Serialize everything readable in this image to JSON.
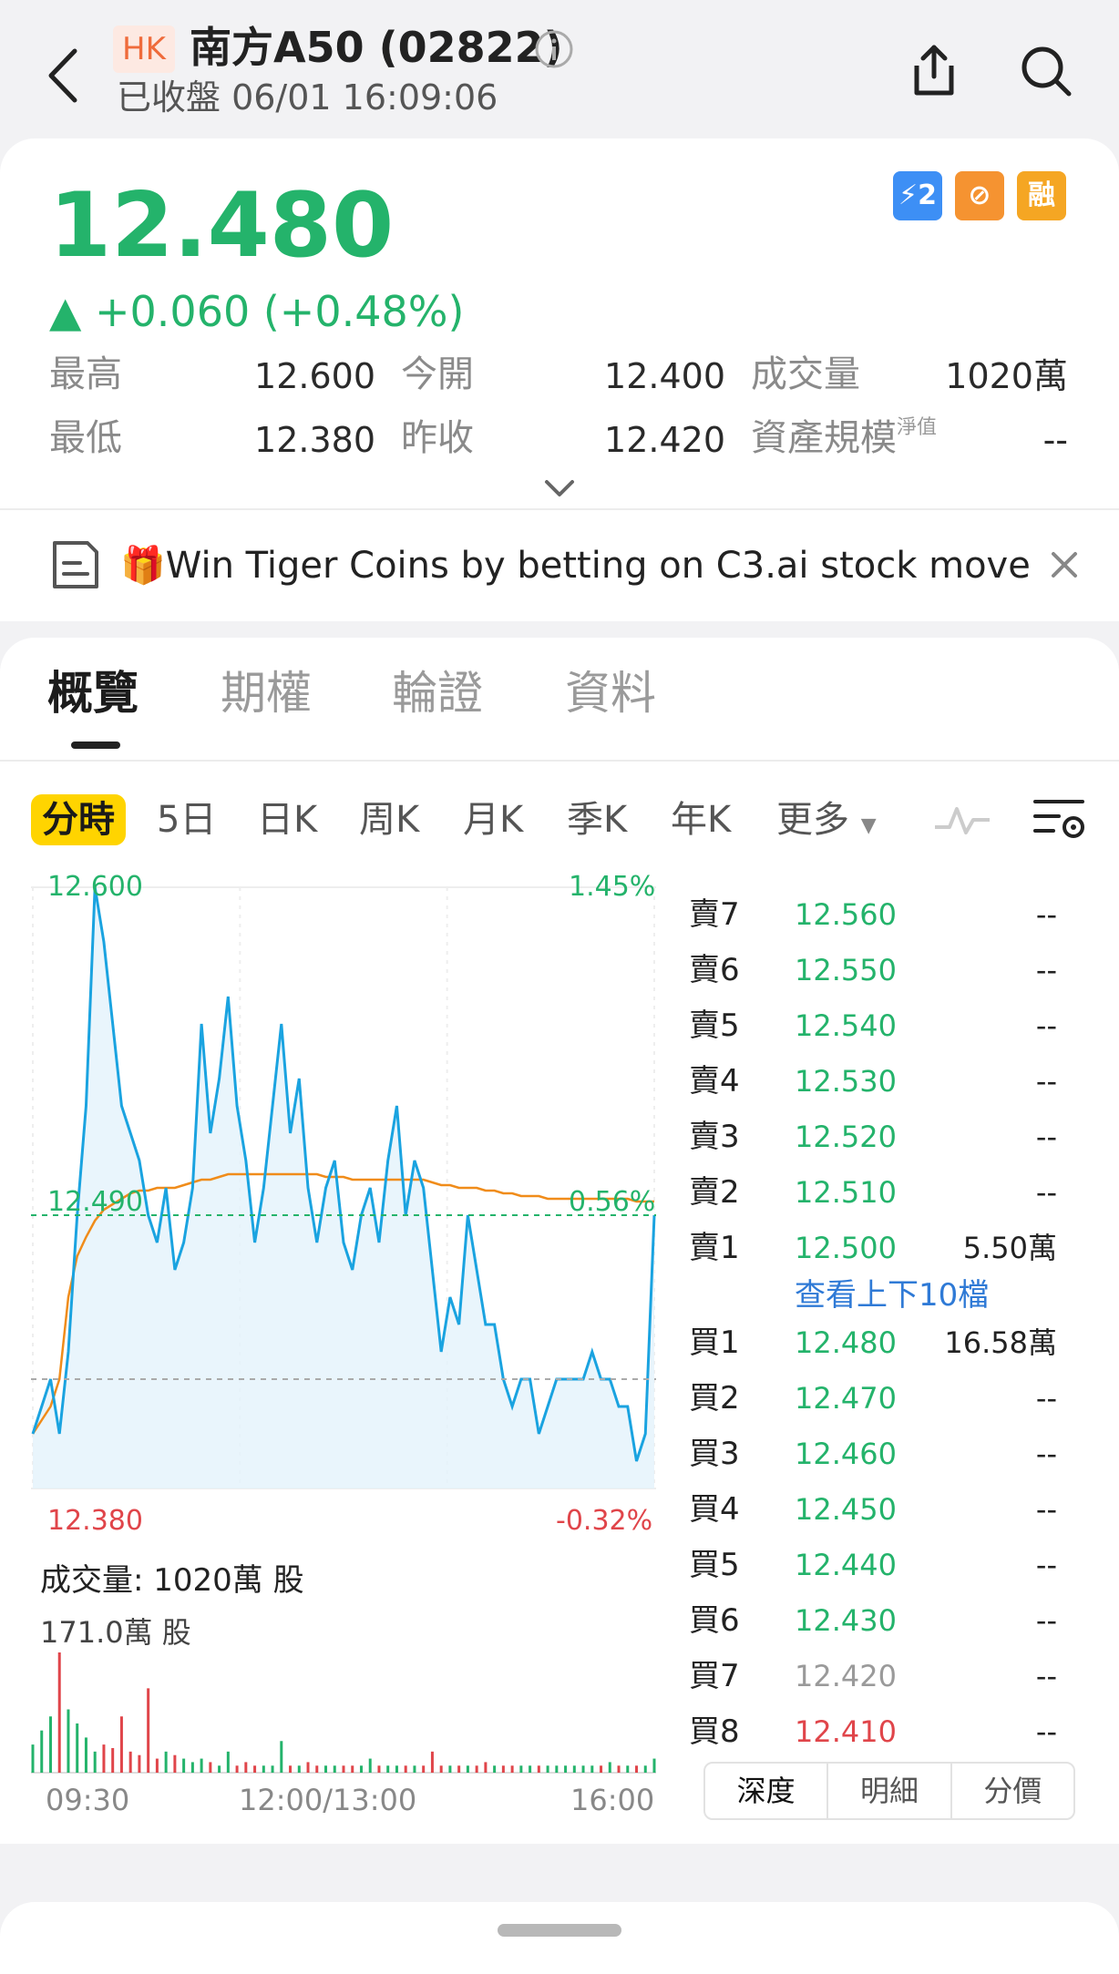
{
  "header": {
    "market_tag": "HK",
    "title": "南方A50 (02822)",
    "status": "已收盤 06/01 16:09:06"
  },
  "quote": {
    "price": "12.480",
    "change": "▲ +0.060 (+0.48%)",
    "badges": [
      {
        "label": "⚡2",
        "color": "#3d8ff5"
      },
      {
        "label": "⊘",
        "color": "#f59331"
      },
      {
        "label": "融",
        "color": "#f5a623"
      }
    ],
    "stats": {
      "high_label": "最高",
      "high": "12.600",
      "open_label": "今開",
      "open": "12.400",
      "volume_label": "成交量",
      "volume": "1020萬",
      "low_label": "最低",
      "low": "12.380",
      "prev_close_label": "昨收",
      "prev_close": "12.420",
      "aum_label": "資產規模",
      "aum_sup": "淨值",
      "aum": "--"
    }
  },
  "promo": {
    "text": "🎁Win Tiger Coins by betting on C3.ai stock move..."
  },
  "tabs": [
    "概覽",
    "期權",
    "輪證",
    "資料"
  ],
  "periods": [
    "分時",
    "5日",
    "日K",
    "周K",
    "月K",
    "季K",
    "年K",
    "更多"
  ],
  "chart": {
    "top_price": "12.600",
    "top_pct": "1.45%",
    "mid_price": "12.490",
    "mid_pct": "0.56%",
    "bottom_price": "12.380",
    "bottom_pct": "-0.32%",
    "volume_title": "成交量:  1020萬 股",
    "volume_max": "171.0萬 股",
    "time_start": "09:30",
    "time_mid": "12:00/13:00",
    "time_end": "16:00"
  },
  "chart_data": {
    "type": "line",
    "title": "",
    "ylim": [
      12.38,
      12.6
    ],
    "prev_close": 12.42,
    "series": [
      {
        "name": "price",
        "values": [
          12.4,
          12.41,
          12.42,
          12.4,
          12.43,
          12.48,
          12.52,
          12.6,
          12.58,
          12.55,
          12.52,
          12.51,
          12.5,
          12.48,
          12.47,
          12.49,
          12.46,
          12.47,
          12.49,
          12.55,
          12.51,
          12.53,
          12.56,
          12.52,
          12.5,
          12.47,
          12.49,
          12.52,
          12.55,
          12.51,
          12.53,
          12.49,
          12.47,
          12.49,
          12.5,
          12.47,
          12.46,
          12.48,
          12.49,
          12.47,
          12.5,
          12.52,
          12.48,
          12.5,
          12.49,
          12.46,
          12.43,
          12.45,
          12.44,
          12.48,
          12.46,
          12.44,
          12.44,
          12.42,
          12.41,
          12.42,
          12.42,
          12.4,
          12.41,
          12.42,
          12.42,
          12.42,
          12.42,
          12.43,
          12.42,
          12.42,
          12.41,
          12.41,
          12.39,
          12.4,
          12.48
        ]
      },
      {
        "name": "avg",
        "values": [
          12.4,
          12.405,
          12.41,
          12.42,
          12.45,
          12.465,
          12.472,
          12.478,
          12.482,
          12.484,
          12.486,
          12.488,
          12.489,
          12.489,
          12.49,
          12.49,
          12.49,
          12.491,
          12.492,
          12.493,
          12.493,
          12.494,
          12.495,
          12.495,
          12.495,
          12.495,
          12.495,
          12.495,
          12.495,
          12.495,
          12.495,
          12.495,
          12.495,
          12.494,
          12.494,
          12.494,
          12.493,
          12.493,
          12.493,
          12.493,
          12.493,
          12.493,
          12.493,
          12.493,
          12.493,
          12.492,
          12.491,
          12.491,
          12.49,
          12.49,
          12.49,
          12.489,
          12.489,
          12.488,
          12.488,
          12.487,
          12.487,
          12.487,
          12.486,
          12.486,
          12.486,
          12.486,
          12.486,
          12.486,
          12.486,
          12.486,
          12.486,
          12.486,
          12.485,
          12.485,
          12.485
        ]
      }
    ],
    "volume": [
      0.4,
      0.6,
      0.8,
      1.71,
      0.9,
      0.7,
      0.5,
      0.3,
      0.4,
      0.35,
      0.8,
      0.3,
      0.25,
      1.2,
      0.2,
      0.3,
      0.25,
      0.2,
      0.15,
      0.2,
      0.15,
      0.1,
      0.3,
      0.1,
      0.15,
      0.1,
      0.1,
      0.1,
      0.45,
      0.1,
      0.1,
      0.15,
      0.1,
      0.1,
      0.1,
      0.1,
      0.1,
      0.1,
      0.2,
      0.1,
      0.1,
      0.1,
      0.1,
      0.1,
      0.1,
      0.3,
      0.1,
      0.1,
      0.1,
      0.1,
      0.1,
      0.15,
      0.1,
      0.1,
      0.1,
      0.1,
      0.1,
      0.1,
      0.1,
      0.1,
      0.1,
      0.1,
      0.1,
      0.1,
      0.1,
      0.15,
      0.1,
      0.1,
      0.1,
      0.1,
      0.2
    ]
  },
  "order_book": {
    "sells": [
      {
        "label": "賣7",
        "price": "12.560",
        "vol": "--"
      },
      {
        "label": "賣6",
        "price": "12.550",
        "vol": "--"
      },
      {
        "label": "賣5",
        "price": "12.540",
        "vol": "--"
      },
      {
        "label": "賣4",
        "price": "12.530",
        "vol": "--"
      },
      {
        "label": "賣3",
        "price": "12.520",
        "vol": "--"
      },
      {
        "label": "賣2",
        "price": "12.510",
        "vol": "--"
      },
      {
        "label": "賣1",
        "price": "12.500",
        "vol": "5.50萬"
      }
    ],
    "link": "查看上下10檔",
    "buys": [
      {
        "label": "買1",
        "price": "12.480",
        "vol": "16.58萬"
      },
      {
        "label": "買2",
        "price": "12.470",
        "vol": "--"
      },
      {
        "label": "買3",
        "price": "12.460",
        "vol": "--"
      },
      {
        "label": "買4",
        "price": "12.450",
        "vol": "--"
      },
      {
        "label": "買5",
        "price": "12.440",
        "vol": "--"
      },
      {
        "label": "買6",
        "price": "12.430",
        "vol": "--"
      },
      {
        "label": "買7",
        "price": "12.420",
        "vol": "--"
      },
      {
        "label": "買8",
        "price": "12.410",
        "vol": "--"
      }
    ],
    "segments": [
      "深度",
      "明細",
      "分價"
    ]
  },
  "colors": {
    "up": "#24b36b",
    "down": "#e0454a",
    "neutral": "#9a9a9a",
    "line": "#1aa3e0",
    "avg": "#f08c1a"
  }
}
